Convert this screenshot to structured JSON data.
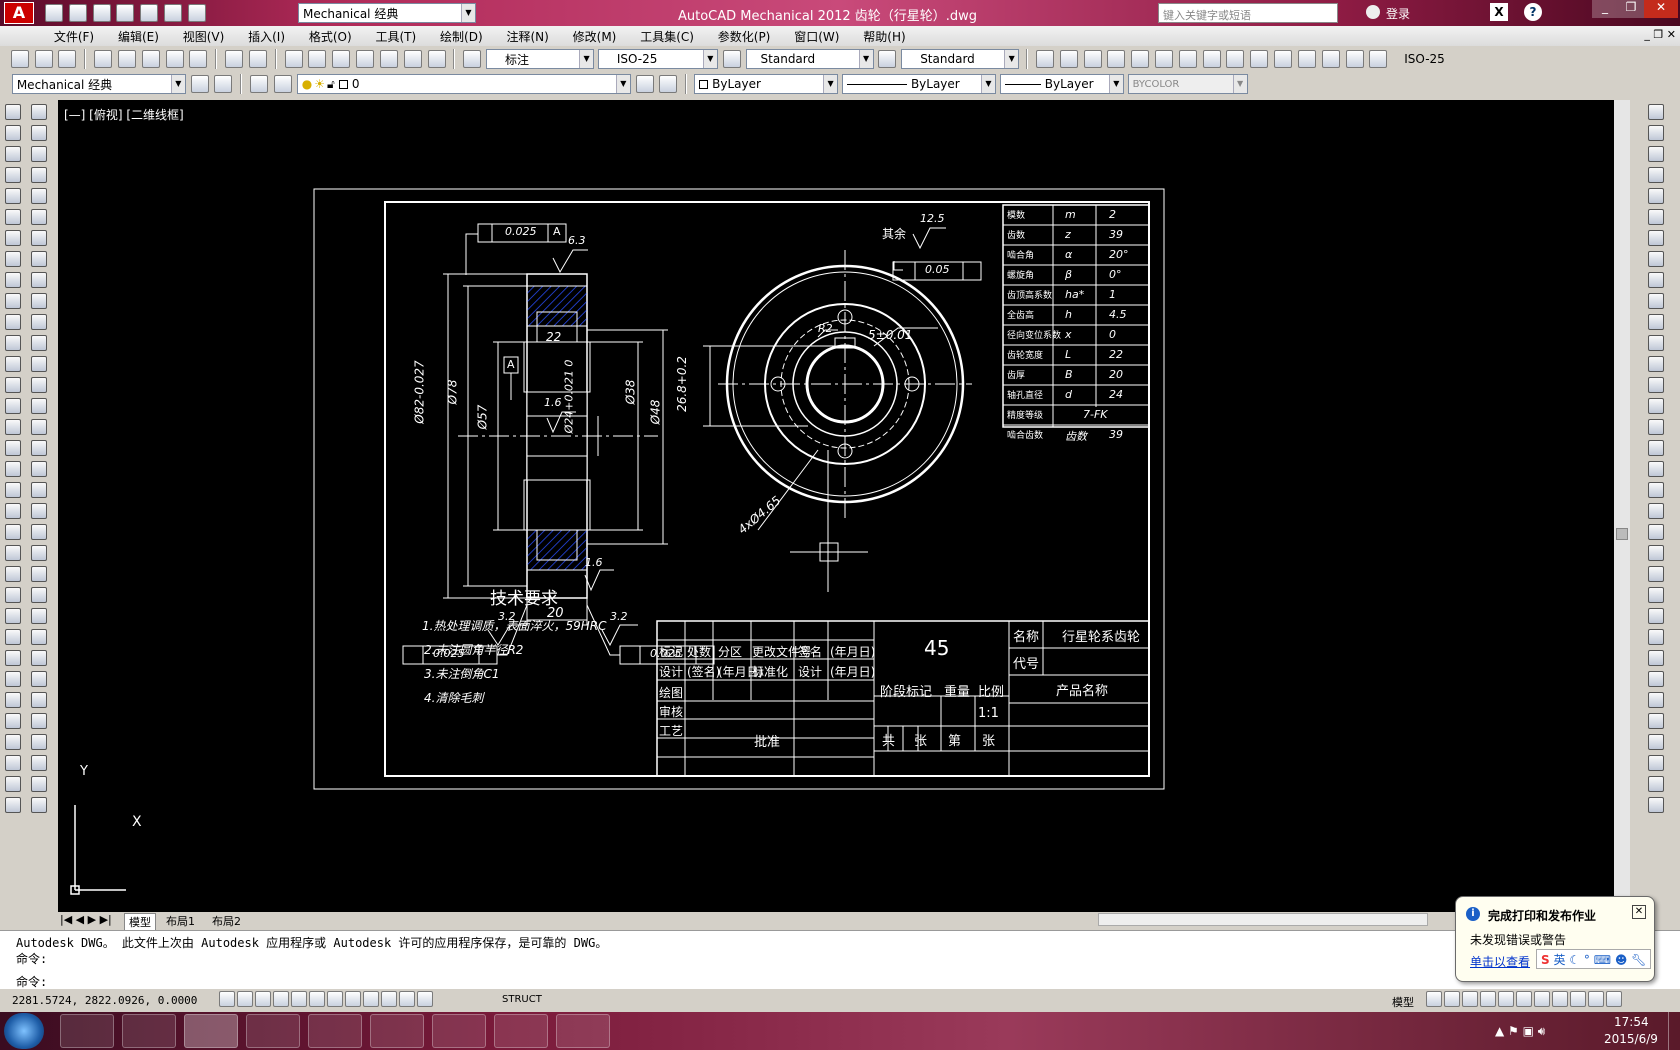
{
  "titlebar": {
    "workspace": "Mechanical 经典",
    "title": "AutoCAD Mechanical 2012    齿轮（行星轮）.dwg",
    "search_placeholder": "键入关键字或短语",
    "login": "登录"
  },
  "menu": [
    "文件(F)",
    "编辑(E)",
    "视图(V)",
    "插入(I)",
    "格式(O)",
    "工具(T)",
    "绘制(D)",
    "注释(N)",
    "修改(M)",
    "工具集(C)",
    "参数化(P)",
    "窗口(W)",
    "帮助(H)"
  ],
  "toolbar1": {
    "dim_style_label": "标注",
    "dim_standard": "ISO-25",
    "text_style": "Standard",
    "table_style": "Standard",
    "right_style": "ISO-25"
  },
  "toolbar2": {
    "workspace": "Mechanical 经典",
    "layer": "0",
    "color": "ByLayer",
    "linetype": "ByLayer",
    "lineweight": "ByLayer",
    "plotstyle": "BYCOLOR"
  },
  "viewport_label": "[—] [俯视] [二维线框]",
  "drawing": {
    "tol_frames": [
      "0.025",
      "0.025",
      "0.025"
    ],
    "tol_datum": "A",
    "flatness": "0.05",
    "roughness_top": "6.3",
    "roughness_rest": "其余",
    "roughness_rest_val": "12.5",
    "roughness_center": "1.6",
    "roughness_bottom": "1.6",
    "roughness_left": "3.2",
    "roughness_right": "3.2",
    "width_dim": "20",
    "hub_dim": "22",
    "dims_left": [
      "Ø82-0.027",
      "Ø78",
      "Ø57"
    ],
    "dims_bore": [
      "Ø24+0.021 0",
      "Ø38",
      "Ø48"
    ],
    "keyway_dim": "26.8+0.2",
    "key_width": "5±0.01",
    "small_radius": "R2",
    "holes_dim": "4xØ4.65",
    "tech_title": "技术要求",
    "tech_items": [
      "1.热处理调质，表面淬火，59HRC",
      "2.未注圆角半径R2",
      "3.未注倒角C1",
      "4.清除毛刺"
    ],
    "params": [
      [
        "模数",
        "m",
        "2"
      ],
      [
        "齿数",
        "z",
        "39"
      ],
      [
        "啮合角",
        "α",
        "20°"
      ],
      [
        "螺旋角",
        "β",
        "0°"
      ],
      [
        "齿顶高系数",
        "ha*",
        "1"
      ],
      [
        "全齿高",
        "h",
        "4.5"
      ],
      [
        "径向变位系数",
        "x",
        "0"
      ],
      [
        "齿轮宽度",
        "L",
        "22"
      ],
      [
        "齿厚",
        "B",
        "20"
      ],
      [
        "轴孔直径",
        "d",
        "24"
      ],
      [
        "精度等级",
        "",
        "7-FK"
      ],
      [
        "啮合齿数",
        "齿数",
        "39"
      ]
    ],
    "title_block": {
      "material": "45",
      "name_label": "名称",
      "name_value": "行星轮系齿轮",
      "code_label": "代号",
      "product_label": "产品名称",
      "row1": [
        "标记",
        "处数",
        "分区",
        "更改文件号",
        "签名",
        "(年月日)"
      ],
      "row2": [
        "设计",
        "(签名)",
        "(年月日)",
        "标准化",
        "设计",
        "(年月日)"
      ],
      "side": [
        "绘图",
        "审核",
        "工艺"
      ],
      "approve": "批准",
      "stage": "阶段标记",
      "weight": "重量",
      "scale": "比例",
      "scale_value": "1:1",
      "sheets": [
        "共",
        "张",
        "第",
        "张"
      ]
    },
    "axis_y": "Y",
    "axis_x": "X"
  },
  "tabs": [
    "模型",
    "布局1",
    "布局2"
  ],
  "command": {
    "line1": "Autodesk DWG。  此文件上次由 Autodesk 应用程序或 Autodesk 许可的应用程序保存，是可靠的 DWG。",
    "line2": "命令:",
    "line3": "命令:"
  },
  "status": {
    "coords": "2281.5724, 2822.0926, 0.0000",
    "struct": "STRUCT",
    "model": "模型"
  },
  "notify": {
    "title": "完成打印和发布作业",
    "body": "未发现错误或警告",
    "link": "单击以查看",
    "ime": "英"
  },
  "clock": {
    "time": "17:54",
    "date": "2015/6/9"
  }
}
